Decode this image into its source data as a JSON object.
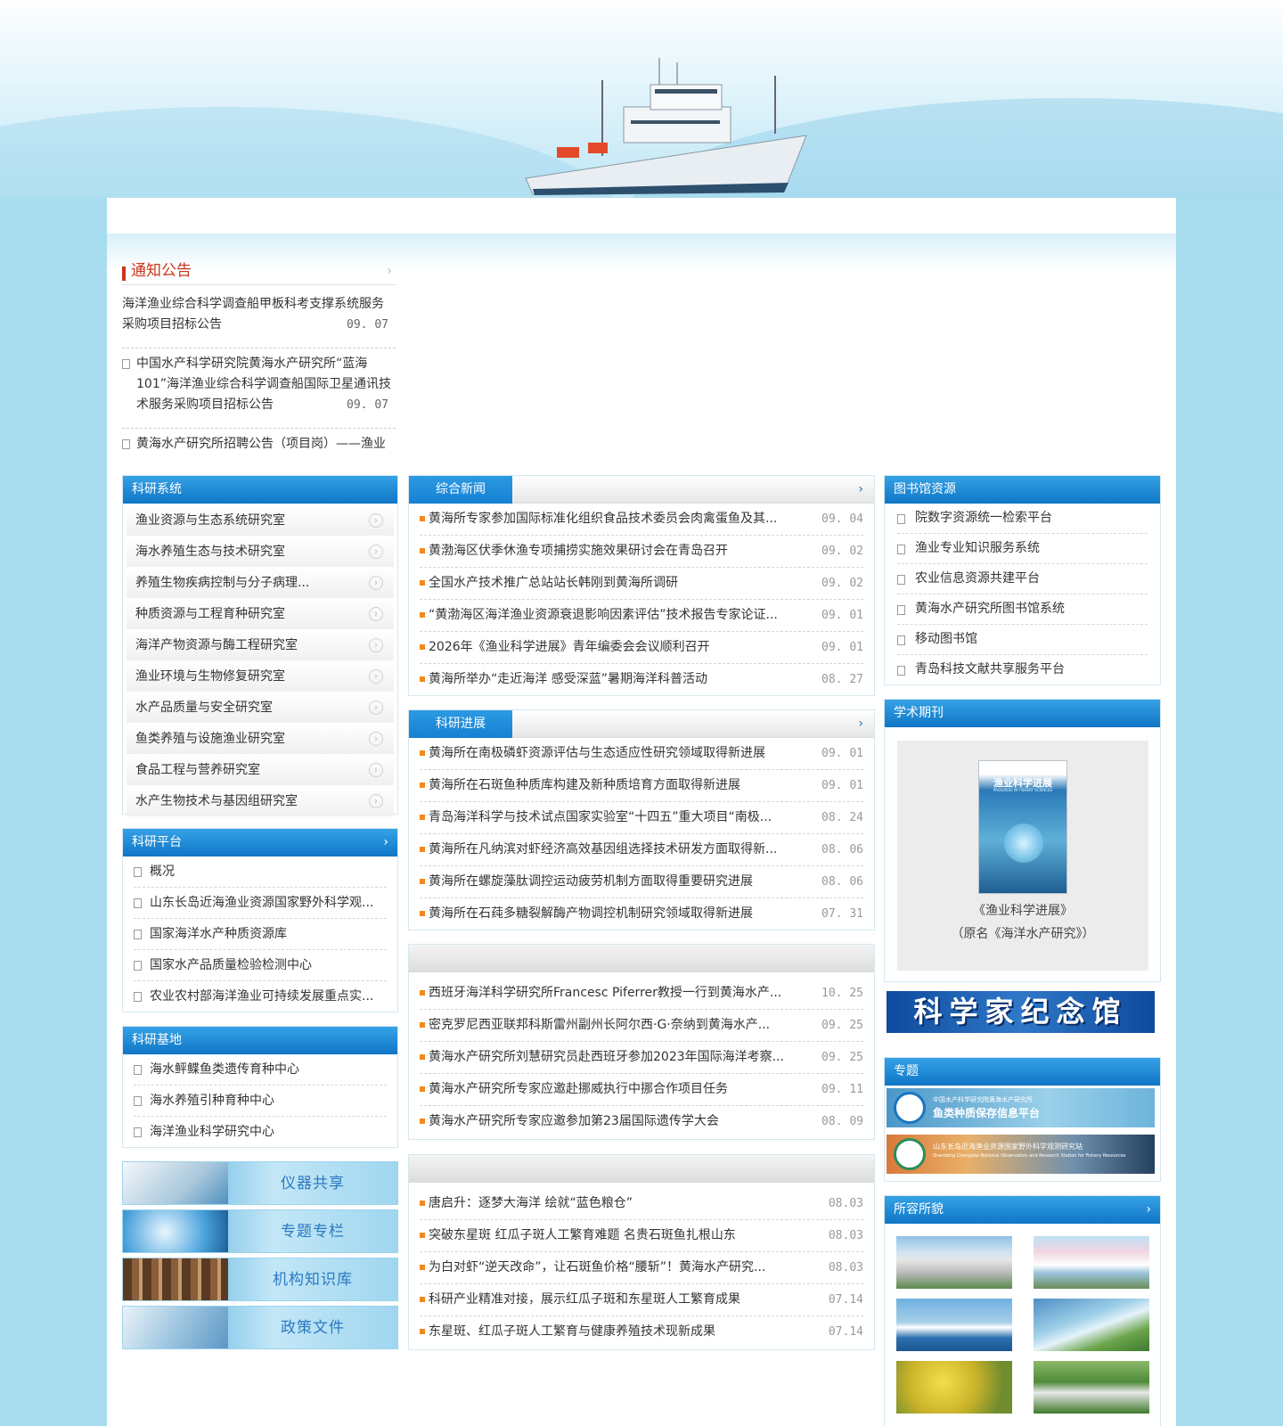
{
  "notice": {
    "title": "通知公告",
    "items": [
      {
        "text": "海洋渔业综合科学调查船甲板科考支撑系统服务采购项目招标公告",
        "date": "09. 07"
      },
      {
        "text": "中国水产科学研究院黄海水产研究所“蓝海101”海洋渔业综合科学调查船国际卫星通讯技术服务采购项目招标公告",
        "date": "09. 07"
      },
      {
        "text": "黄海水产研究所招聘公告（项目岗）——渔业",
        "date": ""
      }
    ]
  },
  "research_system": {
    "title": "科研系统",
    "items": [
      "渔业资源与生态系统研究室",
      "海水养殖生态与技术研究室",
      "养殖生物疾病控制与分子病理...",
      "种质资源与工程育种研究室",
      "海洋产物资源与酶工程研究室",
      "渔业环境与生物修复研究室",
      "水产品质量与安全研究室",
      "鱼类养殖与设施渔业研究室",
      "食品工程与营养研究室",
      "水产生物技术与基因组研究室"
    ]
  },
  "research_platform": {
    "title": "科研平台",
    "items": [
      "概况",
      "山东长岛近海渔业资源国家野外科学观...",
      "国家海洋水产种质资源库",
      "国家水产品质量检验检测中心",
      "农业农村部海洋渔业可持续发展重点实..."
    ]
  },
  "research_base": {
    "title": "科研基地",
    "items": [
      "海水鲆鲽鱼类遗传育种中心",
      "海水养殖引种育种中心",
      "海洋渔业科学研究中心"
    ]
  },
  "banners": [
    "仪器共享",
    "专题专栏",
    "机构知识库",
    "政策文件"
  ],
  "news": {
    "tab": "综合新闻",
    "items": [
      {
        "text": "黄海所专家参加国际标准化组织食品技术委员会肉禽蛋鱼及其...",
        "date": "09. 04"
      },
      {
        "text": "黄渤海区伏季休渔专项捕捞实施效果研讨会在青岛召开",
        "date": "09. 02"
      },
      {
        "text": "全国水产技术推广总站站长韩刚到黄海所调研",
        "date": "09. 02"
      },
      {
        "text": "“黄渤海区海洋渔业资源衰退影响因素评估”技术报告专家论证...",
        "date": "09. 01"
      },
      {
        "text": "2026年《渔业科学进展》青年编委会会议顺利召开",
        "date": "09. 01"
      },
      {
        "text": "黄海所举办“走近海洋 感受深蓝”暑期海洋科普活动",
        "date": "08. 27"
      }
    ]
  },
  "progress": {
    "tab": "科研进展",
    "items": [
      {
        "text": "黄海所在南极磷虾资源评估与生态适应性研究领域取得新进展",
        "date": "09. 01"
      },
      {
        "text": "黄海所在石斑鱼种质库构建及新种质培育方面取得新进展",
        "date": "09. 01"
      },
      {
        "text": "青岛海洋科学与技术试点国家实验室“十四五”重大项目“南极...",
        "date": "08. 24"
      },
      {
        "text": "黄海所在凡纳滨对虾经济高效基因组选择技术研发方面取得新...",
        "date": "08. 06"
      },
      {
        "text": "黄海所在螺旋藻肽调控运动疲劳机制方面取得重要研究进展",
        "date": "08. 06"
      },
      {
        "text": "黄海所在石莼多糖裂解酶产物调控机制研究领域取得新进展",
        "date": "07. 31"
      }
    ]
  },
  "exchange": {
    "items": [
      {
        "text": "西班牙海洋科学研究所Francesc Piferrer教授一行到黄海水产...",
        "date": "10. 25"
      },
      {
        "text": "密克罗尼西亚联邦科斯雷州副州长阿尔西·G·奈纳到黄海水产...",
        "date": "09. 25"
      },
      {
        "text": "黄海水产研究所刘慧研究员赴西班牙参加2023年国际海洋考察...",
        "date": "09. 25"
      },
      {
        "text": "黄海水产研究所专家应邀赴挪威执行中挪合作项目任务",
        "date": "09. 11"
      },
      {
        "text": "黄海水产研究所专家应邀参加第23届国际遗传学大会",
        "date": "08. 09"
      }
    ]
  },
  "media": {
    "items": [
      {
        "text": "唐启升：逐梦大海洋 绘就“蓝色粮仓”",
        "date": "08.03"
      },
      {
        "text": "突破东星斑 红瓜子斑人工繁育难题 名贵石斑鱼扎根山东",
        "date": "08.03"
      },
      {
        "text": "为白对虾“逆天改命”，让石斑鱼价格“腰斩”！黄海水产研究...",
        "date": "08.03"
      },
      {
        "text": "科研产业精准对接，展示红瓜子斑和东星斑人工繁育成果",
        "date": "07.14"
      },
      {
        "text": "东星斑、红瓜子斑人工繁育与健康养殖技术现新成果",
        "date": "07.14"
      }
    ]
  },
  "library": {
    "title": "图书馆资源",
    "items": [
      "院数字资源统一检索平台",
      "渔业专业知识服务系统",
      "农业信息资源共建平台",
      "黄海水产研究所图书馆系统",
      "移动图书馆",
      "青岛科技文献共享服务平台"
    ]
  },
  "journal": {
    "title": "学术期刊",
    "cover_title": "渔业科学进展",
    "cover_subtitle": "PROGRESS IN FISHERY SCIENCES",
    "caption1": "《渔业科学进展》",
    "caption2": "（原名《海洋水产研究》）"
  },
  "scientist_hall": "科学家纪念馆",
  "topics": {
    "title": "专题",
    "items": [
      {
        "line1": "中国水产科学研究院黄海水产研究所",
        "line2": "鱼类种质保存信息平台"
      },
      {
        "line1": "山东长岛近海渔业资源国家野外科学观测研究站",
        "line2": "Shandong Changdao National Observation and Research Station for Fishery Resources"
      }
    ]
  },
  "gallery": {
    "title": "所容所貌"
  },
  "colors": {
    "header_blue": "#1a80d2",
    "accent_orange": "#f08a1c",
    "notice_red": "#c8361c",
    "page_bg": "#a8dcef"
  }
}
